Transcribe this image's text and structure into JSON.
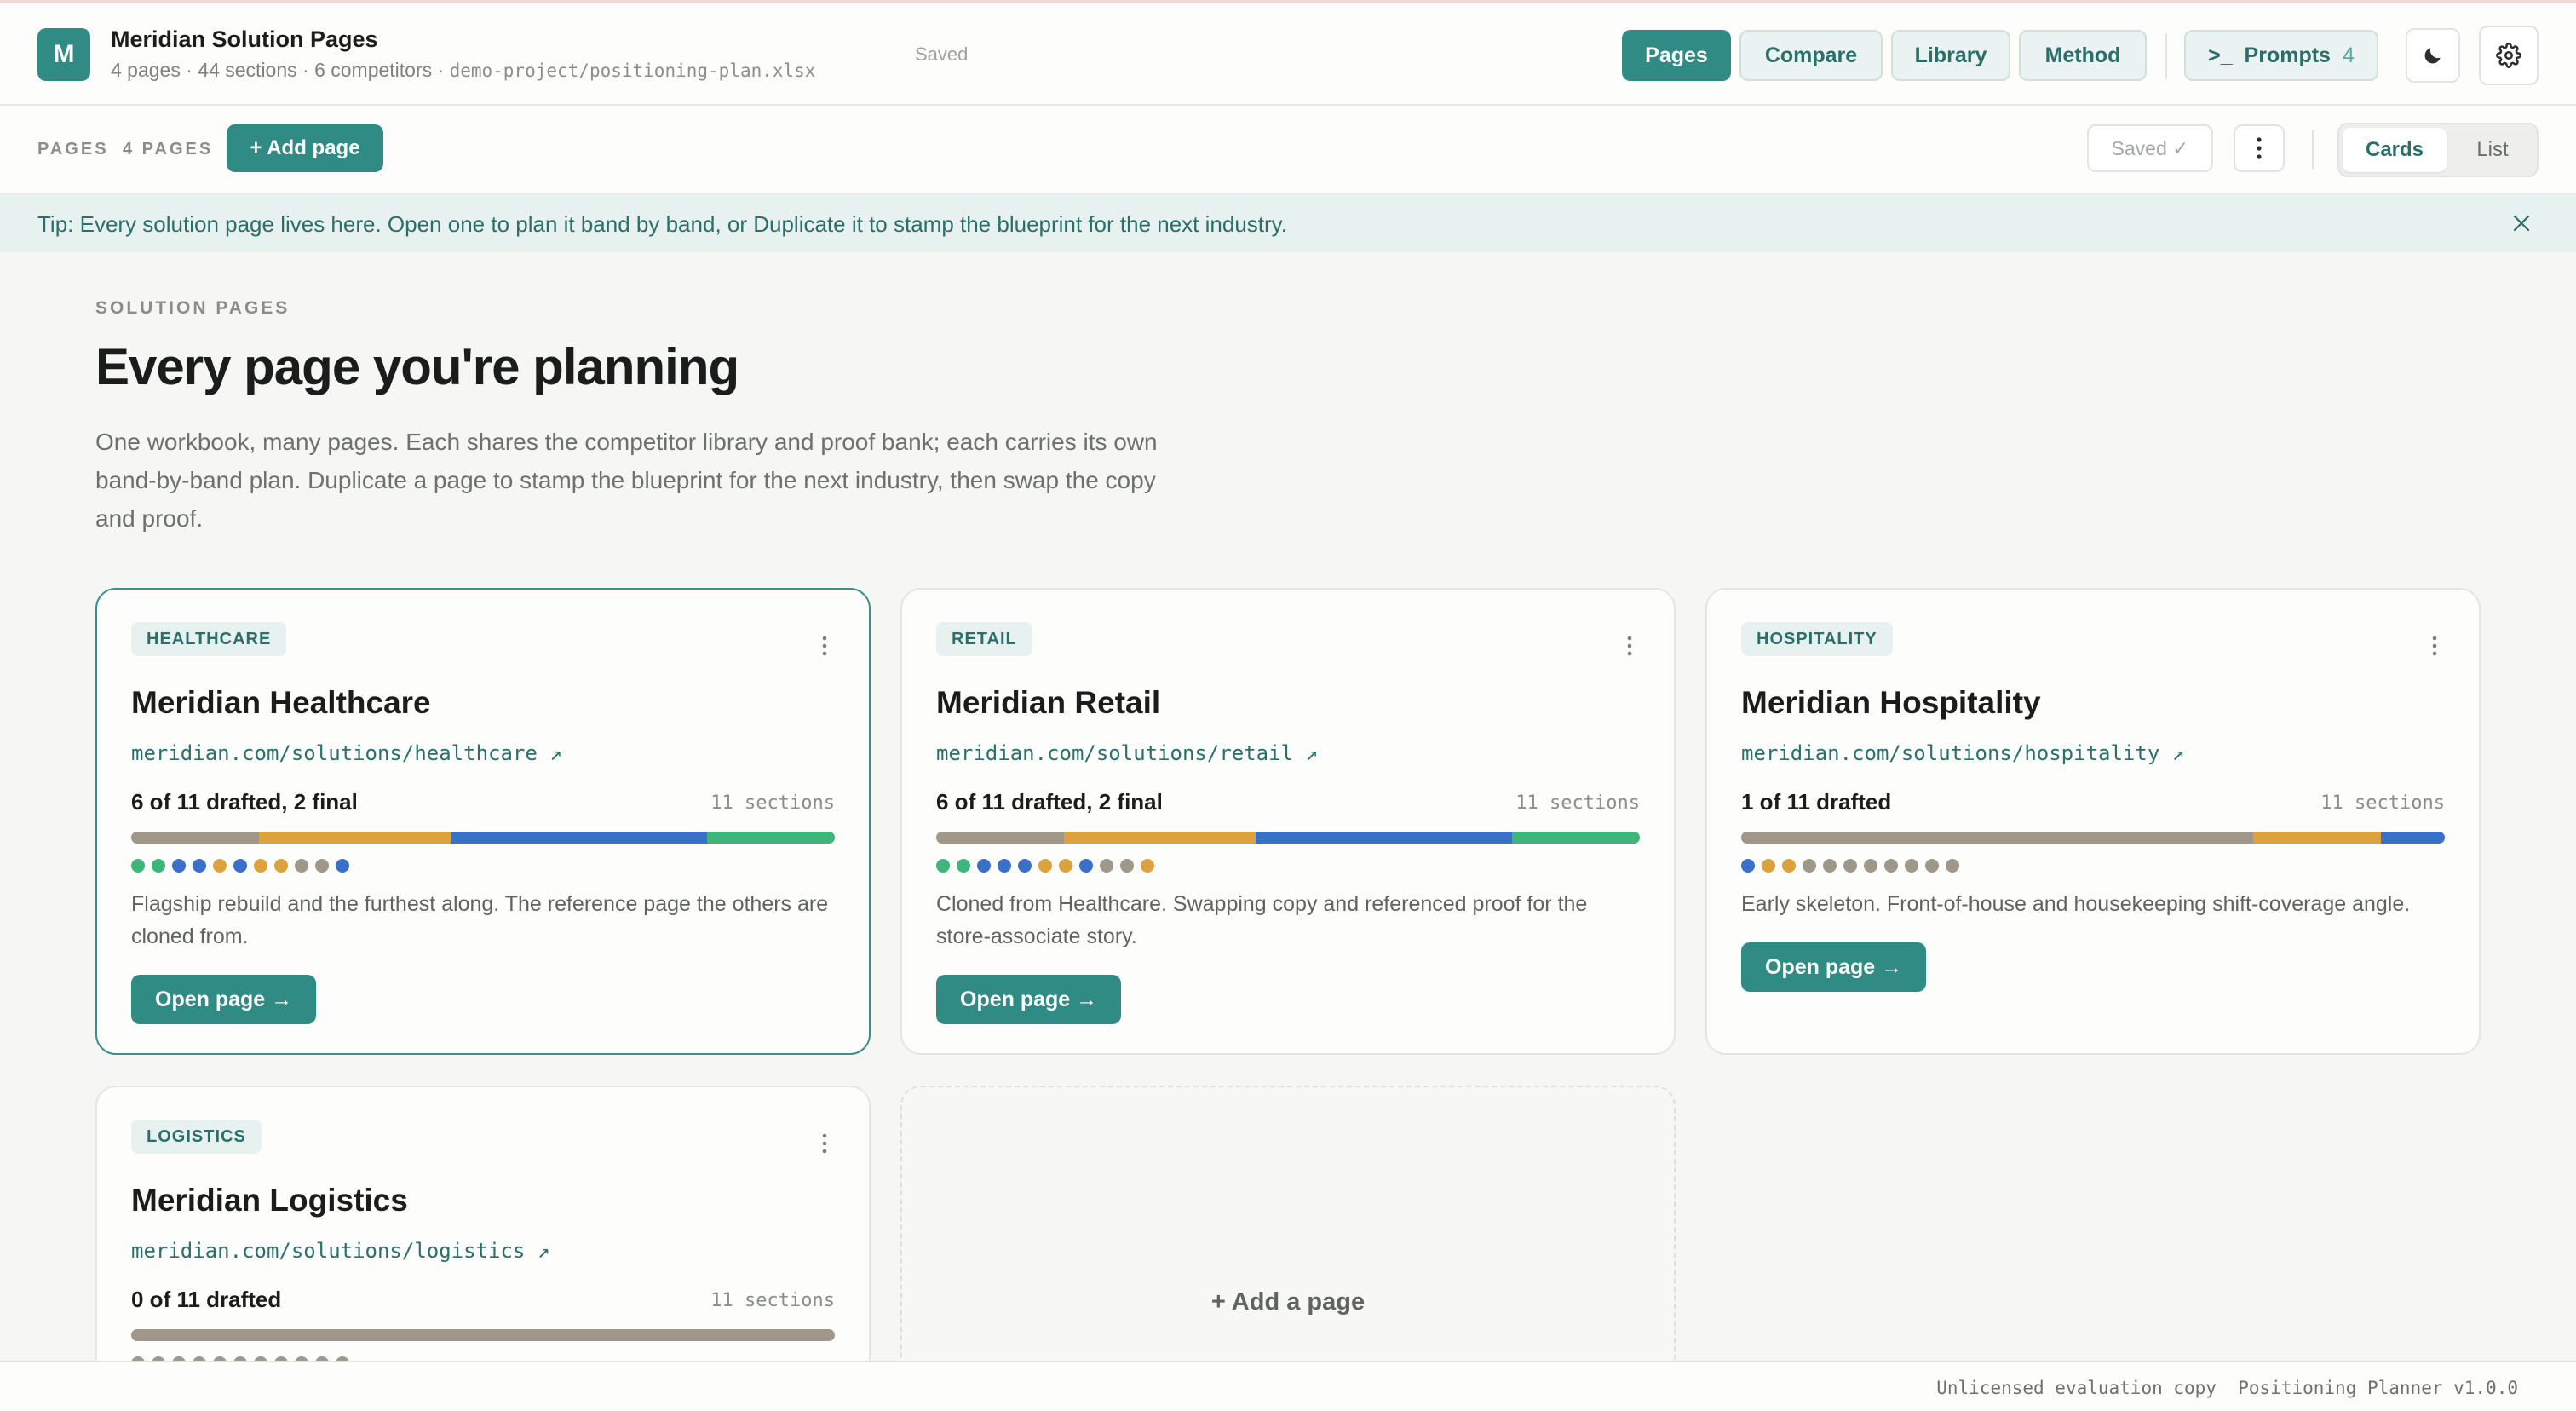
{
  "app": {
    "logo_letter": "M",
    "title": "Meridian Solution Pages",
    "subtitle_counts": "4 pages · 44 sections · 6 competitors · ",
    "file_path": "demo-project/positioning-plan.xlsx",
    "save_status": "Saved"
  },
  "nav": {
    "pages": "Pages",
    "compare": "Compare",
    "library": "Library",
    "method": "Method",
    "prompts_label": ">_  Prompts",
    "prompts_count": "4",
    "active": "Pages"
  },
  "icons": {
    "theme_toggle": "moon-icon",
    "settings": "gear-icon",
    "more": "vertical-dots-icon",
    "close": "close-icon"
  },
  "toolbar": {
    "section_label": "PAGES",
    "page_count": "4 PAGES",
    "add_page": "+ Add page",
    "saved": "Saved ✓",
    "view_cards": "Cards",
    "view_list": "List",
    "active_view": "Cards"
  },
  "tip": {
    "text": "Tip: Every solution page lives here. Open one to plan it band by band, or Duplicate it to stamp the blueprint for the next industry."
  },
  "hero": {
    "eyebrow": "SOLUTION PAGES",
    "title": "Every page you're planning",
    "lede": "One workbook, many pages. Each shares the competitor library and proof bank; each carries its own band-by-band plan. Duplicate a page to stamp the blueprint for the next industry, then swap the copy and proof."
  },
  "colors": {
    "accent": "#2f8b83",
    "status_empty": "#9e978a",
    "status_drafting": "#dca23d",
    "status_drafted": "#3a70c9",
    "status_final": "#3db57b"
  },
  "cards": [
    {
      "tag": "HEALTHCARE",
      "title": "Meridian Healthcare",
      "url": "meridian.com/solutions/healthcare ↗",
      "progress": "6 of 11 drafted, 2 final",
      "sections": "11 sections",
      "bar": [
        {
          "status": "empty",
          "fraction": 0.182
        },
        {
          "status": "drafting",
          "fraction": 0.273
        },
        {
          "status": "drafted",
          "fraction": 0.364
        },
        {
          "status": "final",
          "fraction": 0.182
        }
      ],
      "dots": [
        "final",
        "final",
        "drafted",
        "drafted",
        "drafting",
        "drafted",
        "drafting",
        "drafting",
        "empty",
        "empty",
        "drafted"
      ],
      "description": "Flagship rebuild and the furthest along. The reference page the others are cloned from.",
      "open": "Open page →",
      "selected": true
    },
    {
      "tag": "RETAIL",
      "title": "Meridian Retail",
      "url": "meridian.com/solutions/retail ↗",
      "progress": "6 of 11 drafted, 2 final",
      "sections": "11 sections",
      "bar": [
        {
          "status": "empty",
          "fraction": 0.182
        },
        {
          "status": "drafting",
          "fraction": 0.273
        },
        {
          "status": "drafted",
          "fraction": 0.364
        },
        {
          "status": "final",
          "fraction": 0.182
        }
      ],
      "dots": [
        "final",
        "final",
        "drafted",
        "drafted",
        "drafted",
        "drafting",
        "drafting",
        "drafted",
        "empty",
        "empty",
        "drafting"
      ],
      "description": "Cloned from Healthcare. Swapping copy and referenced proof for the store-associate story.",
      "open": "Open page →",
      "selected": false
    },
    {
      "tag": "HOSPITALITY",
      "title": "Meridian Hospitality",
      "url": "meridian.com/solutions/hospitality ↗",
      "progress": "1 of 11 drafted",
      "sections": "11 sections",
      "bar": [
        {
          "status": "empty",
          "fraction": 0.727
        },
        {
          "status": "drafting",
          "fraction": 0.182
        },
        {
          "status": "drafted",
          "fraction": 0.091
        }
      ],
      "dots": [
        "drafted",
        "drafting",
        "drafting",
        "empty",
        "empty",
        "empty",
        "empty",
        "empty",
        "empty",
        "empty",
        "empty"
      ],
      "description": "Early skeleton. Front-of-house and housekeeping shift-coverage angle.",
      "open": "Open page →",
      "selected": false
    },
    {
      "tag": "LOGISTICS",
      "title": "Meridian Logistics",
      "url": "meridian.com/solutions/logistics ↗",
      "progress": "0 of 11 drafted",
      "sections": "11 sections",
      "bar": [
        {
          "status": "empty",
          "fraction": 1.0
        }
      ],
      "dots": [
        "empty",
        "empty",
        "empty",
        "empty",
        "empty",
        "empty",
        "empty",
        "empty",
        "empty",
        "empty",
        "empty"
      ],
      "description": "",
      "open": "",
      "selected": false
    }
  ],
  "add_card": {
    "label": "+ Add a page"
  },
  "footer": {
    "license": "Unlicensed evaluation copy",
    "version": "Positioning Planner v1.0.0"
  }
}
